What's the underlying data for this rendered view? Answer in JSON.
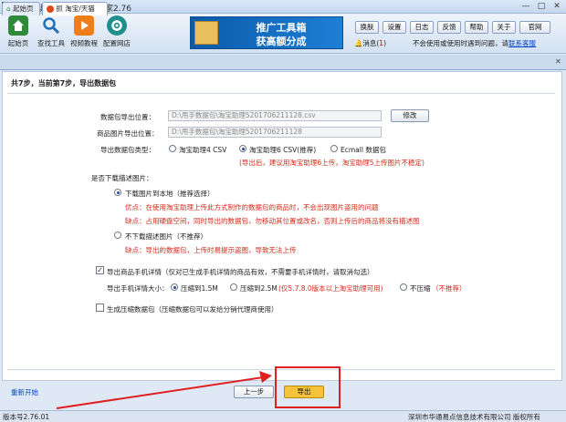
{
  "window": {
    "title": "甩手工具箱 - 商品抓取专家2.76",
    "controls": [
      "—",
      "□",
      "✕"
    ]
  },
  "toolbar": {
    "buttons": [
      {
        "label": "起始页",
        "icon": "home-icon",
        "color": "#2f8a3a"
      },
      {
        "label": "查找工具",
        "icon": "search-icon",
        "color": "#1f6fbf"
      },
      {
        "label": "视频教程",
        "icon": "video-icon",
        "color": "#ef7d18"
      },
      {
        "label": "配置网店",
        "icon": "gear-icon",
        "color": "#1f8f8c"
      }
    ],
    "banner": {
      "line1": "推广工具箱",
      "line2": "获高额分成"
    },
    "top_buttons": [
      "换肤",
      "设置",
      "日志",
      "反馈",
      "帮助",
      "关于",
      "官网"
    ],
    "messages_label": "消息(",
    "messages_count": "1",
    "messages_close": ")",
    "notice_text": "不会使用或使用时遇到问题，请",
    "notice_link": "联系客服"
  },
  "tabs": {
    "home": "起始页",
    "export": "抓 淘宝/天猫",
    "close": "✕"
  },
  "content": {
    "step_title": "共7步，当前第7步，导出数据包",
    "package_path_label": "数据包导出位置：",
    "package_path_value": "D:\\甩手数据包\\淘宝助理5201706211128.csv",
    "modify_button": "修改",
    "image_path_label": "商品图片导出位置：",
    "image_path_value": "D:\\甩手数据包\\淘宝助理5201706211128",
    "type_label": "导出数据包类型：",
    "type_options": [
      "淘宝助理4 CSV",
      "淘宝助理6 CSV(推荐)",
      "Ecmall 数据包"
    ],
    "type_selected": "淘宝助理6 CSV(推荐)",
    "type_warning": "(导出后，建议用淘宝助理6上传，淘宝助理5上传图片不稳定)",
    "desc_question": "是否下载描述图片：",
    "download_option": "下载图片到本地（推荐选择）",
    "download_pro": "优点：在使用淘宝助理上传此方式制作的数据包的商品时，不会出现图片盗用的问题",
    "download_con": "缺点：占用硬盘空间，同时导出的数据包，勿移动其位置或改名，否则上传后的商品将没有描述图",
    "no_download_option": "不下载描述图片（不推荐）",
    "no_download_con": "缺点：导出的数据包，上传时易提示盗图，导致无法上传",
    "mobile_detail_check": "导出商品手机详情（仅对已生成手机详情的商品有效，不需要手机详情时，请取消勾选）",
    "mobile_size_label": "导出手机详情大小：",
    "mobile_size_options": [
      "压缩到1.5M",
      "压缩到2.5M",
      "不压缩"
    ],
    "mobile_size_2_note": "(仅5.7.8.0版本以上淘宝助理可用)",
    "mobile_size_3_note": "（不推荐）",
    "mobile_size_selected": "压缩到1.5M",
    "compress_check": "生成压缩数据包（压缩数据包可以发给分销代理商使用）",
    "restart_link": "重新开始",
    "prev_button": "上一步",
    "export_button": "导出"
  },
  "statusbar": {
    "version": "版本号2.76.01",
    "company": "深圳市华通易点信息技术有限公司 版权所有"
  },
  "colors": {
    "warning_red": "#d42a1c",
    "highlight_box": "#e02020",
    "export_button": "#f5c23a"
  }
}
